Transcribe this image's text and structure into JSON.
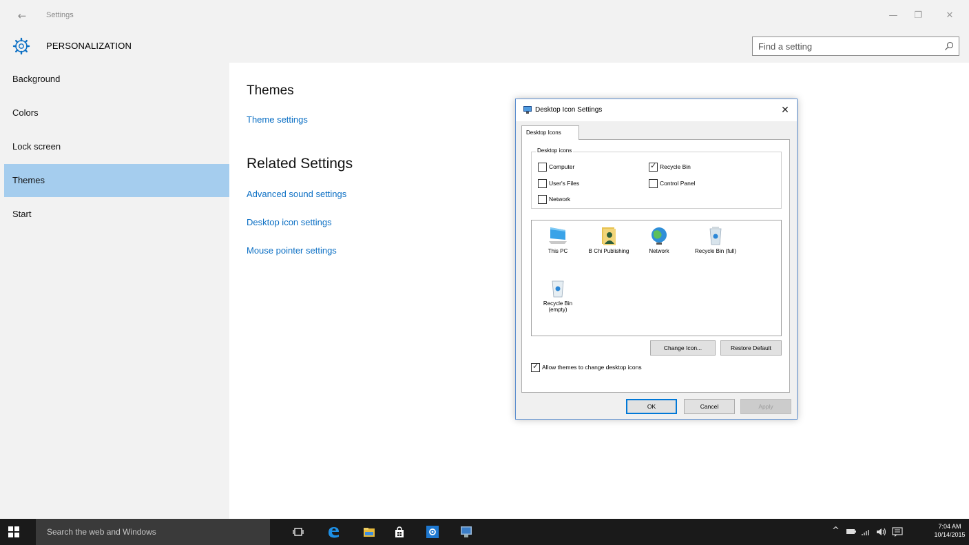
{
  "window": {
    "app_title": "Settings",
    "section_title": "PERSONALIZATION",
    "search_placeholder": "Find a setting"
  },
  "sidebar": {
    "items": [
      {
        "label": "Background"
      },
      {
        "label": "Colors"
      },
      {
        "label": "Lock screen"
      },
      {
        "label": "Themes",
        "selected": true
      },
      {
        "label": "Start"
      }
    ]
  },
  "main": {
    "themes_heading": "Themes",
    "theme_settings_link": "Theme settings",
    "related_heading": "Related Settings",
    "links": [
      "Advanced sound settings",
      "Desktop icon settings",
      "Mouse pointer settings"
    ]
  },
  "dialog": {
    "title": "Desktop Icon Settings",
    "tab_label": "Desktop Icons",
    "group_legend": "Desktop icons",
    "checkboxes": [
      {
        "label": "Computer",
        "checked": false
      },
      {
        "label": "User's Files",
        "checked": false
      },
      {
        "label": "Network",
        "checked": false
      },
      {
        "label": "Recycle Bin",
        "checked": true
      },
      {
        "label": "Control Panel",
        "checked": false
      }
    ],
    "icons": [
      {
        "label": "This PC",
        "icon": "this-pc-icon"
      },
      {
        "label": "B Chi Publishing",
        "icon": "user-files-icon"
      },
      {
        "label": "Network",
        "icon": "network-icon"
      },
      {
        "label": "Recycle Bin (full)",
        "icon": "recycle-bin-full-icon"
      },
      {
        "label": "Recycle Bin (empty)",
        "icon": "recycle-bin-empty-icon"
      }
    ],
    "change_icon_button": "Change Icon...",
    "restore_default_button": "Restore Default",
    "allow_themes_label": "Allow themes to change desktop icons",
    "allow_themes_checked": true,
    "ok_button": "OK",
    "cancel_button": "Cancel",
    "apply_button": "Apply"
  },
  "taskbar": {
    "search_placeholder": "Search the web and Windows",
    "time": "7:04 AM",
    "date": "10/14/2015"
  },
  "colors": {
    "accent": "#0b6fc4",
    "selected_nav": "#a5cdee",
    "taskbar": "#1a1a1a"
  }
}
